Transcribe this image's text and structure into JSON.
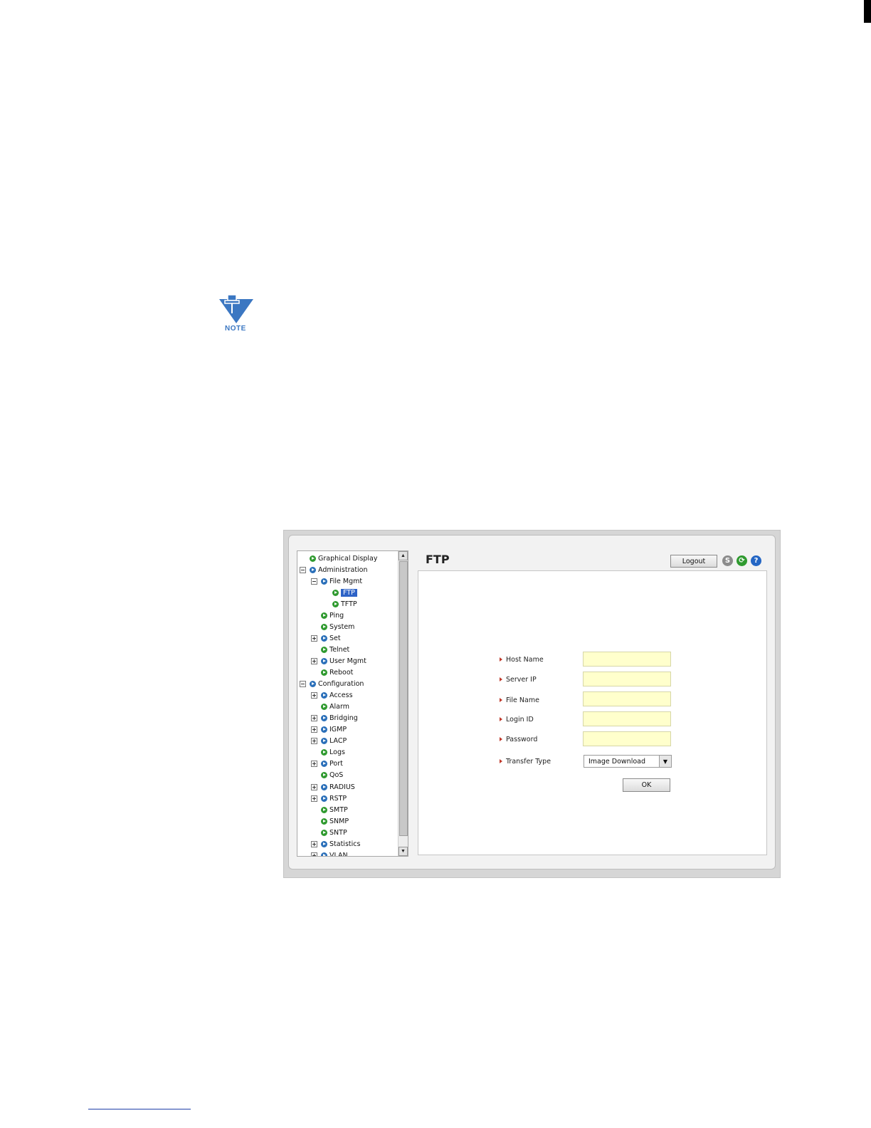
{
  "note": {
    "label": "NOTE"
  },
  "header": {
    "title": "FTP",
    "logout_label": "Logout",
    "save_icon": "S",
    "refresh_icon": "⟳",
    "help_icon": "?"
  },
  "tree": {
    "items": [
      {
        "label": "Graphical Display",
        "bullet": "green"
      },
      {
        "label": "Administration",
        "bullet": "blue",
        "expander": "minus"
      },
      {
        "label": "File Mgmt",
        "bullet": "blue",
        "expander": "minus"
      },
      {
        "label": "FTP",
        "bullet": "green",
        "selected": true
      },
      {
        "label": "TFTP",
        "bullet": "green"
      },
      {
        "label": "Ping",
        "bullet": "green"
      },
      {
        "label": "System",
        "bullet": "green"
      },
      {
        "label": "Set",
        "bullet": "blue",
        "expander": "plus"
      },
      {
        "label": "Telnet",
        "bullet": "green"
      },
      {
        "label": "User Mgmt",
        "bullet": "blue",
        "expander": "plus"
      },
      {
        "label": "Reboot",
        "bullet": "green"
      },
      {
        "label": "Configuration",
        "bullet": "blue",
        "expander": "minus"
      },
      {
        "label": "Access",
        "bullet": "blue",
        "expander": "plus"
      },
      {
        "label": "Alarm",
        "bullet": "green"
      },
      {
        "label": "Bridging",
        "bullet": "blue",
        "expander": "plus"
      },
      {
        "label": "IGMP",
        "bullet": "blue",
        "expander": "plus"
      },
      {
        "label": "LACP",
        "bullet": "blue",
        "expander": "plus"
      },
      {
        "label": "Logs",
        "bullet": "green"
      },
      {
        "label": "Port",
        "bullet": "blue",
        "expander": "plus"
      },
      {
        "label": "QoS",
        "bullet": "green"
      },
      {
        "label": "RADIUS",
        "bullet": "blue",
        "expander": "plus"
      },
      {
        "label": "RSTP",
        "bullet": "blue",
        "expander": "plus"
      },
      {
        "label": "SMTP",
        "bullet": "green"
      },
      {
        "label": "SNMP",
        "bullet": "green"
      },
      {
        "label": "SNTP",
        "bullet": "green"
      },
      {
        "label": "Statistics",
        "bullet": "blue",
        "expander": "plus"
      },
      {
        "label": "VLAN",
        "bullet": "blue",
        "expander": "plus"
      }
    ]
  },
  "form": {
    "host_name_label": "Host Name",
    "host_name_value": "",
    "server_ip_label": "Server IP",
    "server_ip_value": "",
    "file_name_label": "File Name",
    "file_name_value": "",
    "login_id_label": "Login ID",
    "login_id_value": "",
    "password_label": "Password",
    "password_value": "",
    "transfer_type_label": "Transfer Type",
    "transfer_type_value": "Image Download",
    "ok_label": "OK"
  },
  "colors": {
    "input_bg": "#ffffcc",
    "selected_bg": "#2e63c7",
    "bullet_green": "#2f9a2f",
    "bullet_blue": "#2a6fb9",
    "note_blue": "#3b77c2"
  }
}
